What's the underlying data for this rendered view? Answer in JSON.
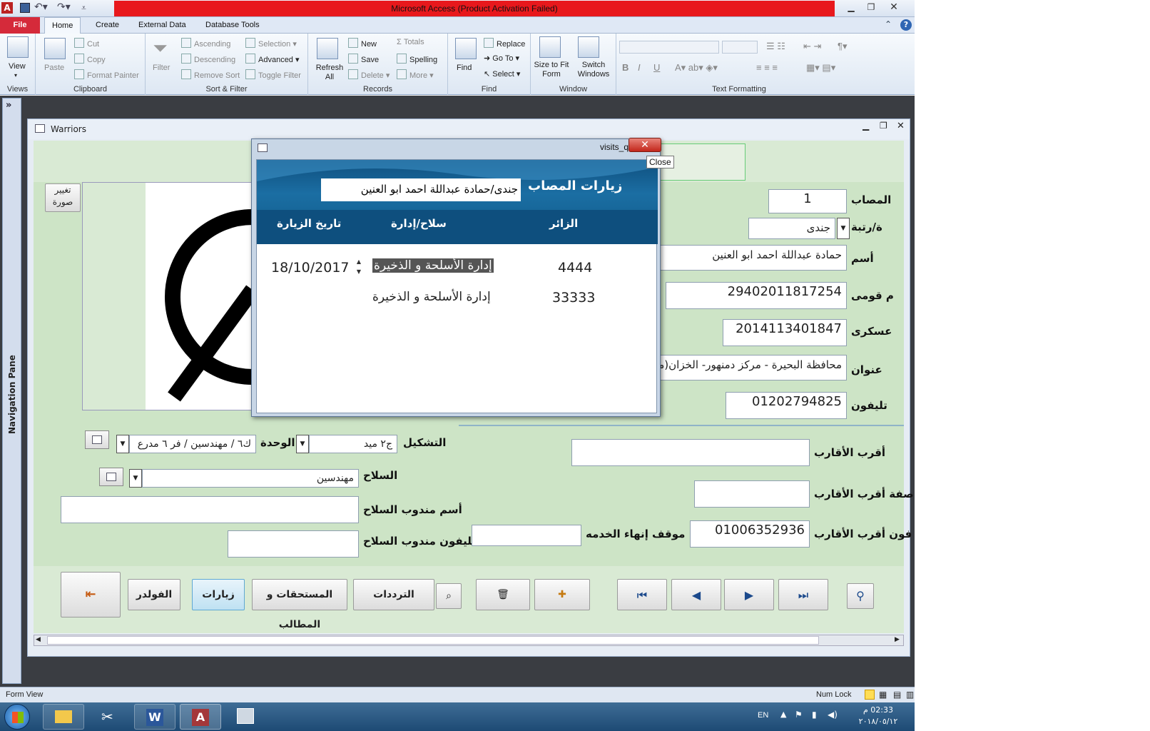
{
  "app": {
    "title": "Microsoft Access (Product Activation Failed)"
  },
  "ribbon": {
    "tabs": [
      "File",
      "Home",
      "Create",
      "External Data",
      "Database Tools"
    ],
    "groups": {
      "views": {
        "label": "Views",
        "view": "View"
      },
      "clipboard": {
        "label": "Clipboard",
        "paste": "Paste",
        "cut": "Cut",
        "copy": "Copy",
        "format_painter": "Format Painter"
      },
      "sort_filter": {
        "label": "Sort & Filter",
        "filter": "Filter",
        "ascending": "Ascending",
        "descending": "Descending",
        "remove_sort": "Remove Sort",
        "selection": "Selection",
        "advanced": "Advanced",
        "toggle_filter": "Toggle Filter"
      },
      "records": {
        "label": "Records",
        "refresh_all": "Refresh All",
        "new": "New",
        "save": "Save",
        "delete": "Delete",
        "totals": "Totals",
        "spelling": "Spelling",
        "more": "More"
      },
      "find": {
        "label": "Find",
        "find": "Find",
        "replace": "Replace",
        "go_to": "Go To",
        "select": "Select"
      },
      "window": {
        "label": "Window",
        "size_to_fit": "Size to Fit Form",
        "switch_windows": "Switch Windows"
      },
      "text_formatting": {
        "label": "Text Formatting"
      }
    }
  },
  "navpane": {
    "label": "Navigation Pane",
    "expand": "»"
  },
  "form": {
    "title": "Warriors",
    "change_photo": "تغيير صورة",
    "fields": {
      "injured_no": {
        "label": "المصاب",
        "value": "1"
      },
      "rank": {
        "label": "ة/رتبة",
        "value": "جندى"
      },
      "name": {
        "label": "أسم",
        "value": "حمادة عبداللة احمد ابو العنين"
      },
      "national_id": {
        "label": "م قومى",
        "value": "29402011817254"
      },
      "military_no": {
        "label": "عسكرى",
        "value": "2014113401847"
      },
      "address": {
        "label": "عنوان",
        "value": "محافظة البحيرة - مركز دمنهور- الخزان(منية بني"
      },
      "phone": {
        "label": "تليفون",
        "value": "01202794825"
      },
      "formation": {
        "label": "التشكيل",
        "value": "ج٢ ميد"
      },
      "unit": {
        "label": "الوحدة",
        "value": "ك٦ / مهندسين / فر ٦ مدرع"
      },
      "weapon": {
        "label": "السلاح",
        "value": "مهندسين"
      },
      "weapon_rep_name": {
        "label": "أسم مندوب السلاح",
        "value": ""
      },
      "weapon_rep_phone": {
        "label": "تليفون مندوب السلاح",
        "value": ""
      },
      "relative": {
        "label": "أقرب الأقارب",
        "value": ""
      },
      "relative_relation": {
        "label": "صفة أقرب الأقارب",
        "value": ""
      },
      "relative_phone": {
        "label": "فون أقرب الأقارب",
        "value": "01006352936"
      },
      "service_end": {
        "label": "موقف إنهاء الخدمه",
        "value": ""
      }
    },
    "buttons": {
      "folder": "الفولدر",
      "visits": "زيارات",
      "dues": "المستحقات و المطالب",
      "frequencies": "الترددات"
    }
  },
  "popup": {
    "title": "visits_q",
    "close_tooltip": "Close",
    "heading": "زيارات المصاب",
    "subject": "جندى/حمادة عبداللة احمد ابو العنين",
    "columns": {
      "visitor": "الزائر",
      "weapon": "سلاح/إدارة",
      "date": "تاريخ الزيارة"
    },
    "rows": [
      {
        "visitor": "4444",
        "weapon": "إدارة الأسلحة و الذخيرة",
        "date": "18/10/2017"
      },
      {
        "visitor": "33333",
        "weapon": "إدارة الأسلحة و الذخيرة",
        "date": ""
      }
    ]
  },
  "statusbar": {
    "left": "Form View",
    "num_lock": "Num Lock"
  },
  "taskbar": {
    "lang": "EN",
    "time": "02:33 م",
    "date": "٢٠١٨/٠٥/١٢"
  },
  "colors": {
    "title_red": "#e8181c",
    "form_green": "#cde4c6",
    "popup_blue": "#1b6ea3",
    "file_tab": "#d52a3a"
  }
}
